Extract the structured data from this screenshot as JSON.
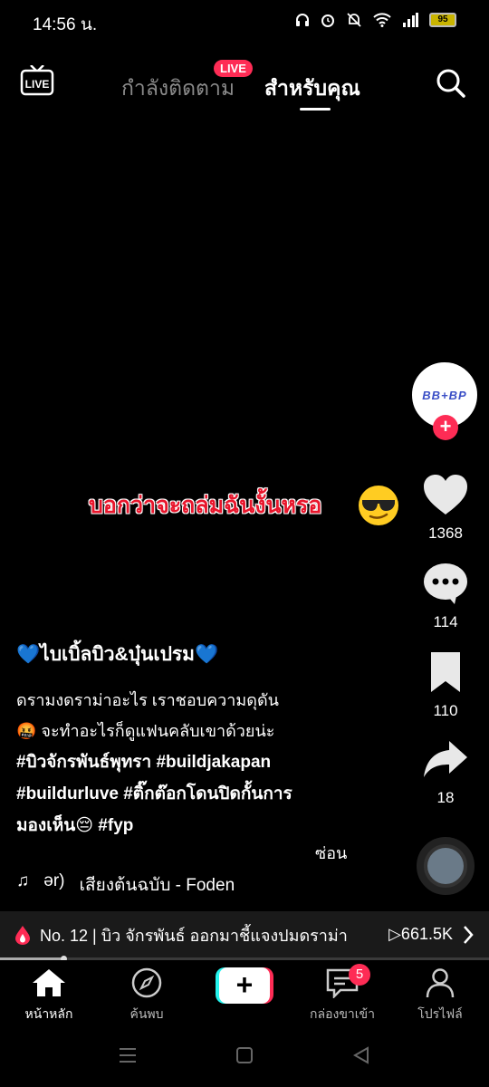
{
  "status_bar": {
    "time": "14:56 น.",
    "battery": "95"
  },
  "top_nav": {
    "live_icon": "live-tv-icon",
    "tab_following": "กำลังติดตาม",
    "live_badge": "LIVE",
    "tab_foryou": "สำหรับคุณ",
    "search_icon": "search-icon"
  },
  "creator": {
    "avatar_text": "BB+BP",
    "follow_plus": "+"
  },
  "actions": {
    "likes": "1368",
    "comments": "114",
    "saves": "110",
    "shares": "18"
  },
  "overlay": {
    "caption": "บอกว่าจะถล่มฉันงั้นหรอ",
    "emoji": "sunglasses-face-icon"
  },
  "description": {
    "title": "💙ไบเบิ้ลบิว&บุ๋นเปรม💙",
    "line1": "ดรามงดราม่าอะไร เราชอบความดุดัน",
    "line2": "🤬 จะทำอะไรก็ดูแฟนคลับเขาด้วยน่ะ",
    "hashtags1": "#บิวจักรพันธ์พุทรา  #buildjakapan",
    "hashtags2": "#buildurluve  #ติ๊กต๊อกโดนปิดกั้นการ",
    "hashtags3": "มองเห็น😔 #fyp",
    "hide": "ซ่อน"
  },
  "music": {
    "note": "♫",
    "prefix": "ər)",
    "title": "เสียงต้นฉบับ - Foden"
  },
  "trending": {
    "text": "No. 12 | บิว จักรพันธ์ ออกมาชี้แจงปมดราม่า",
    "views": "▷661.5K"
  },
  "playback": {
    "progress": 0.13
  },
  "bottom_nav": {
    "home": "หน้าหลัก",
    "discover": "ค้นพบ",
    "create": "+",
    "inbox": "กล่องขาเข้า",
    "inbox_badge": "5",
    "profile": "โปรไฟล์"
  },
  "colors": {
    "accent": "#fe2c55",
    "cyan": "#25f4ee",
    "overlay_text": "#e8162c"
  }
}
